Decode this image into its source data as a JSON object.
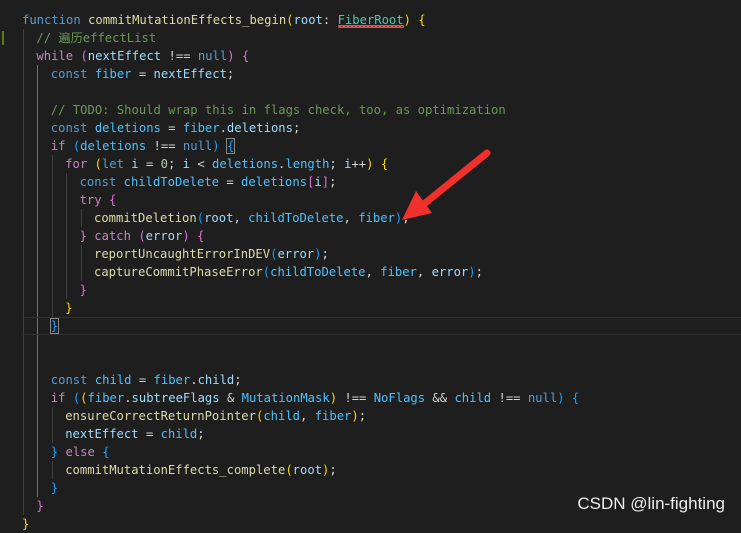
{
  "editor": {
    "background": "#1e1e1e",
    "colors": {
      "keyword": "#569cd6",
      "control": "#c586c0",
      "function": "#dcdcaa",
      "variable": "#9cdcfe",
      "constant": "#4fc1ff",
      "type": "#4ec9b0",
      "comment": "#6a9955",
      "number": "#b5cea8",
      "punct": "#d4d4d4",
      "bracket1": "#ffd700",
      "bracket2": "#da70d6",
      "bracket3": "#179fff",
      "error_squiggle": "#f14c4c"
    },
    "lines": [
      [
        [
          "function",
          "keyword"
        ],
        [
          " ",
          "punct"
        ],
        [
          "commitMutationEffects_begin",
          "function"
        ],
        [
          "(",
          "bracket1"
        ],
        [
          "root",
          "variable"
        ],
        [
          ": ",
          "punct"
        ],
        [
          "FiberRoot",
          "type"
        ],
        [
          ")",
          "bracket1"
        ],
        [
          " ",
          "punct"
        ],
        [
          "{",
          "bracket1"
        ]
      ],
      [
        [
          "// 遍历effectList",
          "comment"
        ]
      ],
      [
        [
          "while",
          "control"
        ],
        [
          " ",
          "punct"
        ],
        [
          "(",
          "bracket2"
        ],
        [
          "nextEffect",
          "variable"
        ],
        [
          " !== ",
          "punct"
        ],
        [
          "null",
          "keyword"
        ],
        [
          ")",
          "bracket2"
        ],
        [
          " ",
          "punct"
        ],
        [
          "{",
          "bracket2"
        ]
      ],
      [
        [
          "const",
          "keyword"
        ],
        [
          " ",
          "punct"
        ],
        [
          "fiber",
          "constant"
        ],
        [
          " = ",
          "punct"
        ],
        [
          "nextEffect",
          "variable"
        ],
        [
          ";",
          "punct"
        ]
      ],
      [],
      [
        [
          "// TODO: Should wrap this in flags check, too, as optimization",
          "comment"
        ]
      ],
      [
        [
          "const",
          "keyword"
        ],
        [
          " ",
          "punct"
        ],
        [
          "deletions",
          "constant"
        ],
        [
          " = ",
          "punct"
        ],
        [
          "fiber",
          "constant"
        ],
        [
          ".",
          "punct"
        ],
        [
          "deletions",
          "variable"
        ],
        [
          ";",
          "punct"
        ]
      ],
      [
        [
          "if",
          "control"
        ],
        [
          " ",
          "punct"
        ],
        [
          "(",
          "bracket3"
        ],
        [
          "deletions",
          "constant"
        ],
        [
          " !== ",
          "punct"
        ],
        [
          "null",
          "keyword"
        ],
        [
          ")",
          "bracket3"
        ],
        [
          " ",
          "punct"
        ],
        [
          "{",
          "bracket3"
        ]
      ],
      [
        [
          "for",
          "control"
        ],
        [
          " ",
          "punct"
        ],
        [
          "(",
          "bracket1"
        ],
        [
          "let",
          "keyword"
        ],
        [
          " ",
          "punct"
        ],
        [
          "i",
          "variable"
        ],
        [
          " = ",
          "punct"
        ],
        [
          "0",
          "number"
        ],
        [
          "; ",
          "punct"
        ],
        [
          "i",
          "variable"
        ],
        [
          " < ",
          "punct"
        ],
        [
          "deletions",
          "constant"
        ],
        [
          ".",
          "punct"
        ],
        [
          "length",
          "constant"
        ],
        [
          "; ",
          "punct"
        ],
        [
          "i",
          "variable"
        ],
        [
          "++",
          "punct"
        ],
        [
          ")",
          "bracket1"
        ],
        [
          " ",
          "punct"
        ],
        [
          "{",
          "bracket1"
        ]
      ],
      [
        [
          "const",
          "keyword"
        ],
        [
          " ",
          "punct"
        ],
        [
          "childToDelete",
          "constant"
        ],
        [
          " = ",
          "punct"
        ],
        [
          "deletions",
          "constant"
        ],
        [
          "[",
          "bracket2"
        ],
        [
          "i",
          "variable"
        ],
        [
          "]",
          "bracket2"
        ],
        [
          ";",
          "punct"
        ]
      ],
      [
        [
          "try",
          "control"
        ],
        [
          " ",
          "punct"
        ],
        [
          "{",
          "bracket2"
        ]
      ],
      [
        [
          "commitDeletion",
          "function"
        ],
        [
          "(",
          "bracket3"
        ],
        [
          "root",
          "variable"
        ],
        [
          ", ",
          "punct"
        ],
        [
          "childToDelete",
          "constant"
        ],
        [
          ", ",
          "punct"
        ],
        [
          "fiber",
          "constant"
        ],
        [
          ")",
          "bracket3"
        ],
        [
          ";",
          "punct"
        ]
      ],
      [
        [
          "}",
          "bracket2"
        ],
        [
          " ",
          "punct"
        ],
        [
          "catch",
          "control"
        ],
        [
          " ",
          "punct"
        ],
        [
          "(",
          "bracket2"
        ],
        [
          "error",
          "variable"
        ],
        [
          ")",
          "bracket2"
        ],
        [
          " ",
          "punct"
        ],
        [
          "{",
          "bracket2"
        ]
      ],
      [
        [
          "reportUncaughtErrorInDEV",
          "function"
        ],
        [
          "(",
          "bracket3"
        ],
        [
          "error",
          "variable"
        ],
        [
          ")",
          "bracket3"
        ],
        [
          ";",
          "punct"
        ]
      ],
      [
        [
          "captureCommitPhaseError",
          "function"
        ],
        [
          "(",
          "bracket3"
        ],
        [
          "childToDelete",
          "constant"
        ],
        [
          ", ",
          "punct"
        ],
        [
          "fiber",
          "constant"
        ],
        [
          ", ",
          "punct"
        ],
        [
          "error",
          "variable"
        ],
        [
          ")",
          "bracket3"
        ],
        [
          ";",
          "punct"
        ]
      ],
      [
        [
          "}",
          "bracket2"
        ]
      ],
      [
        [
          "}",
          "bracket1"
        ]
      ],
      [
        [
          "}",
          "bracket3"
        ]
      ],
      [],
      [],
      [
        [
          "const",
          "keyword"
        ],
        [
          " ",
          "punct"
        ],
        [
          "child",
          "constant"
        ],
        [
          " = ",
          "punct"
        ],
        [
          "fiber",
          "constant"
        ],
        [
          ".",
          "punct"
        ],
        [
          "child",
          "variable"
        ],
        [
          ";",
          "punct"
        ]
      ],
      [
        [
          "if",
          "control"
        ],
        [
          " ",
          "punct"
        ],
        [
          "(",
          "bracket3"
        ],
        [
          "(",
          "bracket1"
        ],
        [
          "fiber",
          "constant"
        ],
        [
          ".",
          "punct"
        ],
        [
          "subtreeFlags",
          "variable"
        ],
        [
          " & ",
          "punct"
        ],
        [
          "MutationMask",
          "constant"
        ],
        [
          ")",
          "bracket1"
        ],
        [
          " !== ",
          "punct"
        ],
        [
          "NoFlags",
          "constant"
        ],
        [
          " && ",
          "punct"
        ],
        [
          "child",
          "constant"
        ],
        [
          " !== ",
          "punct"
        ],
        [
          "null",
          "keyword"
        ],
        [
          ")",
          "bracket3"
        ],
        [
          " ",
          "punct"
        ],
        [
          "{",
          "bracket3"
        ]
      ],
      [
        [
          "ensureCorrectReturnPointer",
          "function"
        ],
        [
          "(",
          "bracket1"
        ],
        [
          "child",
          "constant"
        ],
        [
          ", ",
          "punct"
        ],
        [
          "fiber",
          "constant"
        ],
        [
          ")",
          "bracket1"
        ],
        [
          ";",
          "punct"
        ]
      ],
      [
        [
          "nextEffect",
          "variable"
        ],
        [
          " = ",
          "punct"
        ],
        [
          "child",
          "constant"
        ],
        [
          ";",
          "punct"
        ]
      ],
      [
        [
          "}",
          "bracket3"
        ],
        [
          " ",
          "punct"
        ],
        [
          "else",
          "control"
        ],
        [
          " ",
          "punct"
        ],
        [
          "{",
          "bracket3"
        ]
      ],
      [
        [
          "commitMutationEffects_complete",
          "function"
        ],
        [
          "(",
          "bracket1"
        ],
        [
          "root",
          "variable"
        ],
        [
          ")",
          "bracket1"
        ],
        [
          ";",
          "punct"
        ]
      ],
      [
        [
          "}",
          "bracket3"
        ]
      ],
      [
        [
          "}",
          "bracket2"
        ]
      ],
      [
        [
          "}",
          "bracket1"
        ]
      ]
    ]
  },
  "annotation": {
    "arrow_color": "#f0302a"
  },
  "watermark": {
    "text": "CSDN @lin-fighting"
  }
}
